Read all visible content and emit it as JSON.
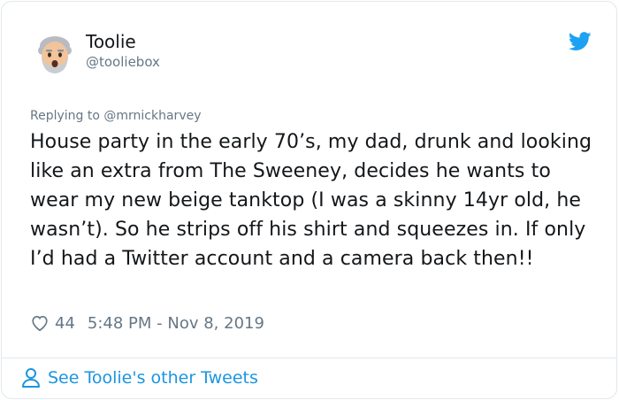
{
  "tweet": {
    "author_name": "Toolie",
    "author_handle": "@tooliebox",
    "replying_prefix": "Replying to ",
    "replying_to": "@mrnickharvey",
    "text": "House party in the early 70’s, my dad, drunk and looking like an extra from The Sweeney, decides he wants to wear my new beige tanktop (I was a skinny 14yr old, he wasn’t). So he strips off his shirt and squeezes in. If only I’d had a Twitter account and a camera back then!!",
    "likes": "44",
    "timestamp": "5:48 PM - Nov 8, 2019"
  },
  "footer": {
    "see_more_label": "See Toolie's other Tweets"
  },
  "icons": {
    "avatar": "old-man-emoji-avatar",
    "brand": "twitter-bird-icon",
    "like": "heart-icon",
    "profile": "person-icon"
  },
  "colors": {
    "brand_blue": "#1da1f2",
    "link_blue": "#1b95e0",
    "muted_gray": "#657786",
    "text_dark": "#14171a",
    "border": "#e1e8ed"
  }
}
